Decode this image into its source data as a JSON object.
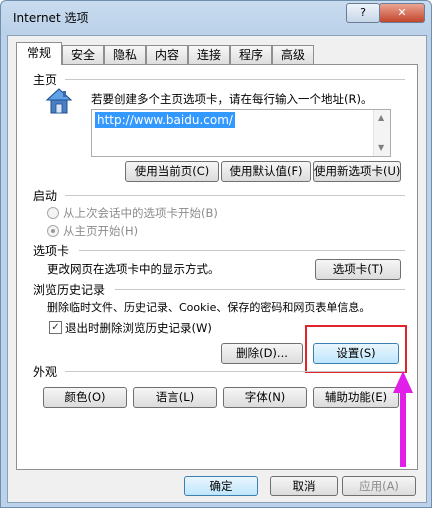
{
  "window": {
    "title": "Internet 选项",
    "help_label": "?",
    "close_label": "✕"
  },
  "tabs": [
    "常规",
    "安全",
    "隐私",
    "内容",
    "连接",
    "程序",
    "高级"
  ],
  "home": {
    "section_title": "主页",
    "hint": "若要创建多个主页选项卡，请在每行输入一个地址(R)。",
    "url": "http://www.baidu.com/",
    "buttons": [
      "使用当前页(C)",
      "使用默认值(F)",
      "使用新选项卡(U)"
    ]
  },
  "startup": {
    "section_title": "启动",
    "options": [
      {
        "label": "从上次会话中的选项卡开始(B)",
        "selected": false
      },
      {
        "label": "从主页开始(H)",
        "selected": true
      }
    ]
  },
  "tabs_section": {
    "section_title": "选项卡",
    "description": "更改网页在选项卡中的显示方式。",
    "button": "选项卡(T)"
  },
  "history": {
    "section_title": "浏览历史记录",
    "description": "删除临时文件、历史记录、Cookie、保存的密码和网页表单信息。",
    "checkbox_label": "退出时删除浏览历史记录(W)",
    "checkbox_checked": true,
    "delete_button": "删除(D)...",
    "settings_button": "设置(S)"
  },
  "appearance": {
    "section_title": "外观",
    "buttons": [
      "颜色(O)",
      "语言(L)",
      "字体(N)",
      "辅助功能(E)"
    ]
  },
  "footer": {
    "ok": "确定",
    "cancel": "取消",
    "apply": "应用(A)"
  },
  "colors": {
    "highlight": "#e0242b",
    "arrow": "#e020e8",
    "selection": "#3399ff"
  }
}
